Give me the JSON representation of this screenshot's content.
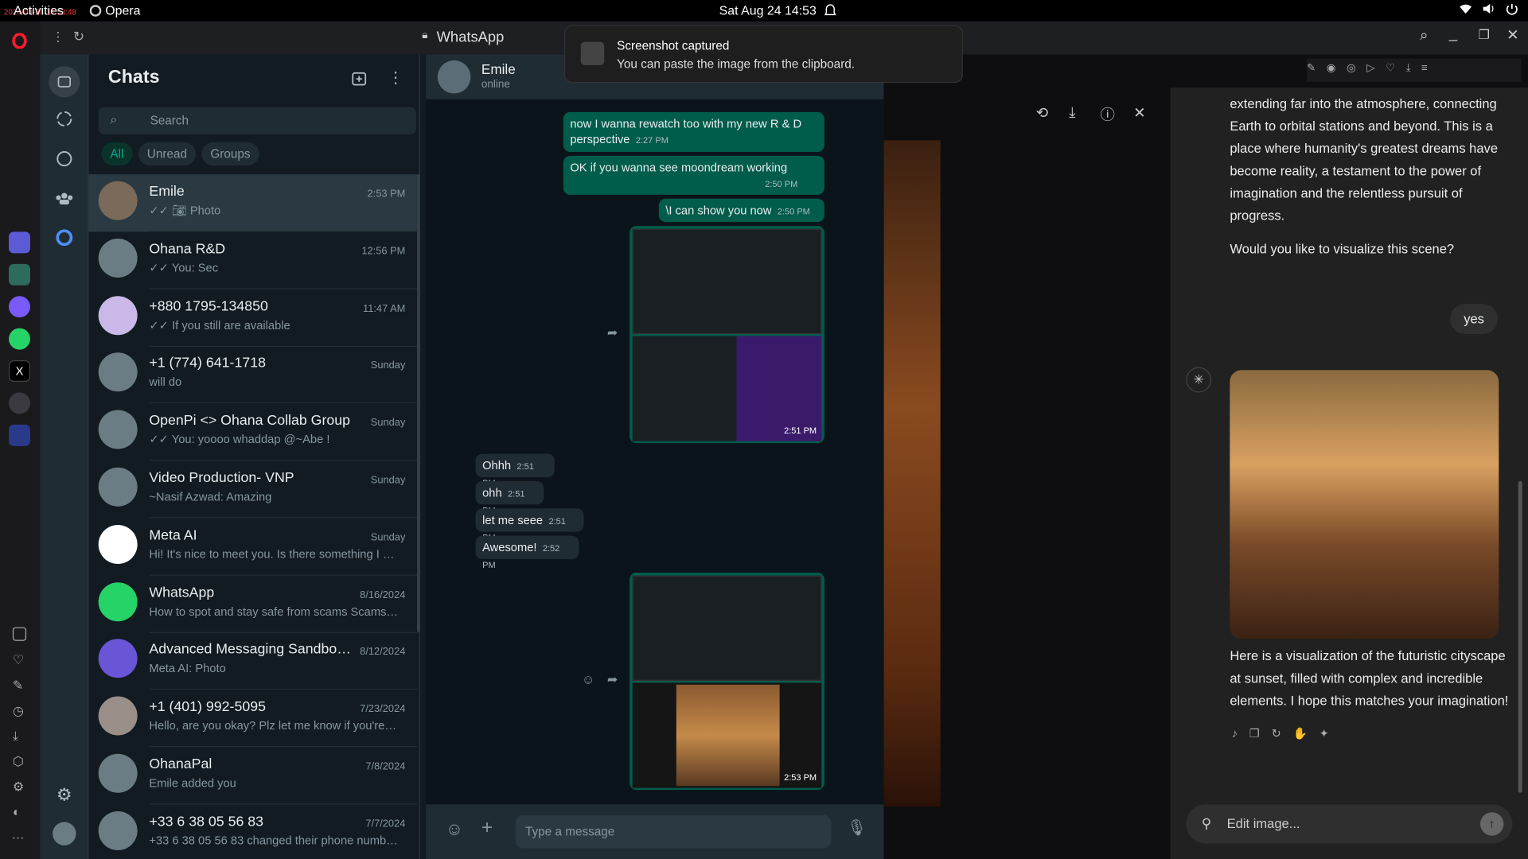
{
  "system": {
    "activities": "Activities",
    "app": "Opera",
    "clock": "Sat Aug 24  14:53",
    "tiny_red": "2024-08-24 14:53:48"
  },
  "browser": {
    "title": "WhatsApp"
  },
  "notification": {
    "title": "Screenshot captured",
    "body": "You can paste the image from the clipboard."
  },
  "sidebar": {
    "title": "Chats",
    "search_placeholder": "Search",
    "filters": [
      "All",
      "Unread",
      "Groups"
    ]
  },
  "chats": [
    {
      "name": "Emile",
      "preview": "Photo",
      "time": "2:53 PM",
      "ticks": true,
      "photo": true
    },
    {
      "name": "Ohana R&D",
      "preview": "You: Sec",
      "time": "12:56 PM",
      "ticks": true
    },
    {
      "name": "+880 1795-134850",
      "preview": "If you still are available",
      "time": "11:47 AM",
      "ticks": true
    },
    {
      "name": "+1 (774) 641-1718",
      "preview": "will do",
      "time": "Sunday"
    },
    {
      "name": "OpenPi <> Ohana Collab Group",
      "preview": "You: yoooo whaddap @~Abe !",
      "time": "Sunday",
      "ticks": true
    },
    {
      "name": "Video Production- VNP",
      "preview": "~Nasif Azwad: Amazing",
      "time": "Sunday"
    },
    {
      "name": "Meta AI",
      "preview": "Hi! It's nice to meet you. Is there something I can h...",
      "time": "Sunday"
    },
    {
      "name": "WhatsApp",
      "preview": "How to spot and stay safe from scams Scams ...",
      "time": "8/16/2024"
    },
    {
      "name": "Advanced Messaging Sandbox B...",
      "preview": "Meta AI: Photo",
      "time": "8/12/2024"
    },
    {
      "name": "+1 (401) 992-5095",
      "preview": "Hello, are you okay? Plz let me know if you're still i...",
      "time": "7/23/2024"
    },
    {
      "name": "OhanaPal",
      "preview": "Emile added you",
      "time": "7/8/2024"
    },
    {
      "name": "+33 6 38 05 56 83",
      "preview": "+33 6 38 05 56 83 changed their phone number to...",
      "time": "7/7/2024"
    }
  ],
  "conversation": {
    "contact": "Emile",
    "status": "online",
    "messages": [
      {
        "text": "now I wanna rewatch too with my new R & D perspective",
        "time": "2:27 PM"
      },
      {
        "text": "OK if you wanna see moondream working",
        "time": "2:50 PM"
      },
      {
        "text": "\\I can show you now",
        "time": "2:50 PM"
      },
      {
        "text": "",
        "time": "2:51 PM"
      },
      {
        "text": "Ohhh",
        "time": "2:51 PM"
      },
      {
        "text": "ohh",
        "time": "2:51 PM"
      },
      {
        "text": "let me seee",
        "time": "2:51 PM"
      },
      {
        "text": "Awesome!",
        "time": "2:52 PM"
      },
      {
        "text": "",
        "time": "2:53 PM"
      }
    ],
    "composer_placeholder": "Type a message"
  },
  "chatgpt": {
    "text1": "extending far into the atmosphere, connecting Earth to orbital stations and beyond. This is a place where humanity's greatest dreams have become reality, a testament to the power of imagination and the relentless pursuit of progress.",
    "question": "Would you like to visualize this scene?",
    "user_reply": "yes",
    "answer": "Here is a visualization of the futuristic cityscape at sunset, filled with complex and incredible elements. I hope this matches your imagination!",
    "input_placeholder": "Edit image..."
  }
}
